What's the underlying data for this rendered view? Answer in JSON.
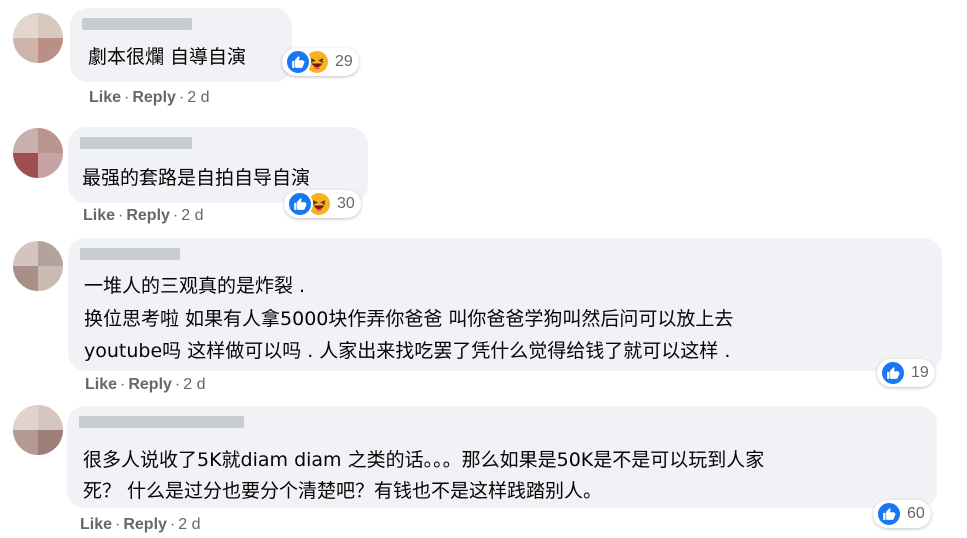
{
  "comments": [
    {
      "text_lines": [
        "劇本很爛 自導自演"
      ],
      "actions": {
        "like": "Like",
        "reply": "Reply",
        "time": "2 d"
      },
      "reactions": {
        "icons": [
          "like-icon",
          "haha-icon"
        ],
        "count": "29"
      }
    },
    {
      "text_lines": [
        "最强的套路是自拍自导自演"
      ],
      "actions": {
        "like": "Like",
        "reply": "Reply",
        "time": "2 d"
      },
      "reactions": {
        "icons": [
          "like-icon",
          "haha-icon"
        ],
        "count": "30"
      }
    },
    {
      "text_lines": [
        "一堆人的三观真的是炸裂 .",
        "换位思考啦 如果有人拿5000块作弄你爸爸 叫你爸爸学狗叫然后问可以放上去",
        "youtube吗 这样做可以吗 . 人家出来找吃罢了凭什么觉得给钱了就可以这样 ."
      ],
      "actions": {
        "like": "Like",
        "reply": "Reply",
        "time": "2 d"
      },
      "reactions": {
        "icons": [
          "like-icon"
        ],
        "count": "19"
      }
    },
    {
      "text_lines": [
        "很多人说收了5K就diam diam 之类的话。。。那么如果是50K是不是可以玩到人家",
        "死？ 什么是过分也要分个清楚吧？有钱也不是这样践踏别人。"
      ],
      "actions": {
        "like": "Like",
        "reply": "Reply",
        "time": "2 d"
      },
      "reactions": {
        "icons": [
          "like-icon"
        ],
        "count": "60"
      }
    }
  ],
  "colors": {
    "bubble": "#f0f2f5",
    "like_blue": "#1877f2",
    "haha_yellow": "#f7b125",
    "meta_gray": "#65676b",
    "text": "#050505"
  }
}
